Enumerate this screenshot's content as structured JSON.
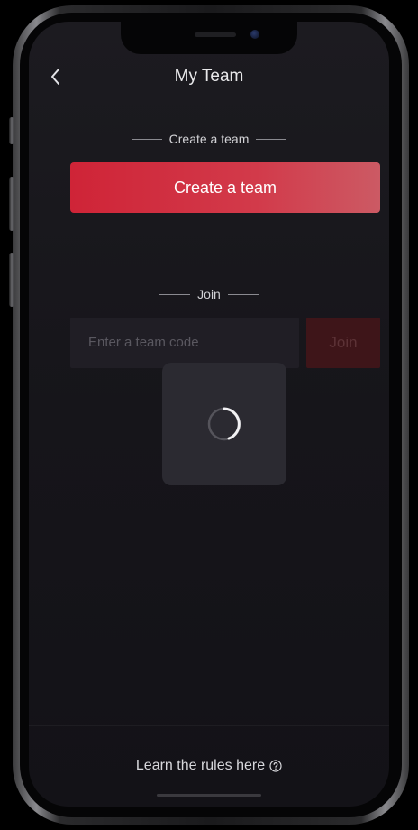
{
  "nav": {
    "title": "My Team",
    "back_icon": "chevron-left-icon"
  },
  "create_section": {
    "label": "Create a team",
    "button_label": "Create a team"
  },
  "join_section": {
    "label": "Join",
    "input_value": "",
    "input_placeholder": "Enter a team code",
    "button_label": "Join"
  },
  "loading": {
    "icon": "spinner-icon"
  },
  "footer": {
    "rules_text": "Learn the rules here",
    "help_icon": "question-circle-icon"
  },
  "colors": {
    "accent": "#cf2437",
    "background": "#17161b",
    "loader_bg": "#2b2a31"
  }
}
